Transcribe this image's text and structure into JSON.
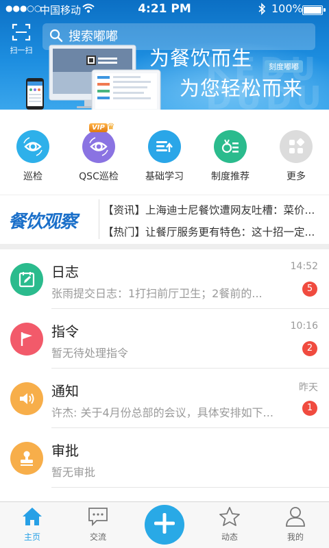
{
  "status_bar": {
    "signal": "●●●○○",
    "carrier": "中国移动",
    "time": "4:21 PM",
    "battery": "100%"
  },
  "header": {
    "scan_label": "扫一扫",
    "search_placeholder": "搜索嘟嘟",
    "slogan_line1": "为餐饮而生",
    "slogan_line2": "为您轻松而来",
    "brand_tag": "刻度嘟嘟",
    "watermark": "KEDU DUDU"
  },
  "quick_menu": [
    {
      "label": "巡检",
      "icon": "eye-scan-icon",
      "color": "#2eb0ea"
    },
    {
      "label": "QSC巡检",
      "icon": "eye-scan-icon",
      "color": "#8a73e2",
      "badge": "VIP"
    },
    {
      "label": "基础学习",
      "icon": "study-icon",
      "color": "#2aa6e8"
    },
    {
      "label": "制度推荐",
      "icon": "medal-list-icon",
      "color": "#2bbb8d"
    },
    {
      "label": "更多",
      "icon": "grid-more-icon",
      "color": "#dcdcdc"
    }
  ],
  "news": {
    "logo_text": "餐饮观察",
    "items": [
      "【资讯】上海迪士尼餐饮遭网友吐槽：菜价...",
      "【热门】让餐厅服务更有特色：这十招一定..."
    ]
  },
  "messages": [
    {
      "title": "日志",
      "subtitle": "张雨提交日志：1打扫前厅卫生；2餐前的...",
      "time": "14:52",
      "badge": "5",
      "icon": "journal-edit-icon",
      "color": "#2bbb8d"
    },
    {
      "title": "指令",
      "subtitle": "暂无待处理指令",
      "time": "10:16",
      "badge": "2",
      "icon": "flag-icon",
      "color": "#f25a6a"
    },
    {
      "title": "通知",
      "subtitle": "许杰: 关于4月份总部的会议，具体安排如下...",
      "time": "昨天",
      "badge": "1",
      "icon": "speaker-icon",
      "color": "#f7ae4a"
    },
    {
      "title": "审批",
      "subtitle": "暂无审批",
      "time": "",
      "badge": "",
      "icon": "stamp-icon",
      "color": "#f7ae4a"
    }
  ],
  "tabbar": {
    "items": [
      {
        "label": "主页",
        "icon": "home-icon",
        "active": true
      },
      {
        "label": "交流",
        "icon": "chat-icon",
        "active": false
      },
      {
        "label": "",
        "icon": "plus-icon",
        "active": false
      },
      {
        "label": "动态",
        "icon": "star-icon",
        "active": false
      },
      {
        "label": "我的",
        "icon": "user-icon",
        "active": false
      }
    ],
    "active_color": "#27a0e6"
  }
}
